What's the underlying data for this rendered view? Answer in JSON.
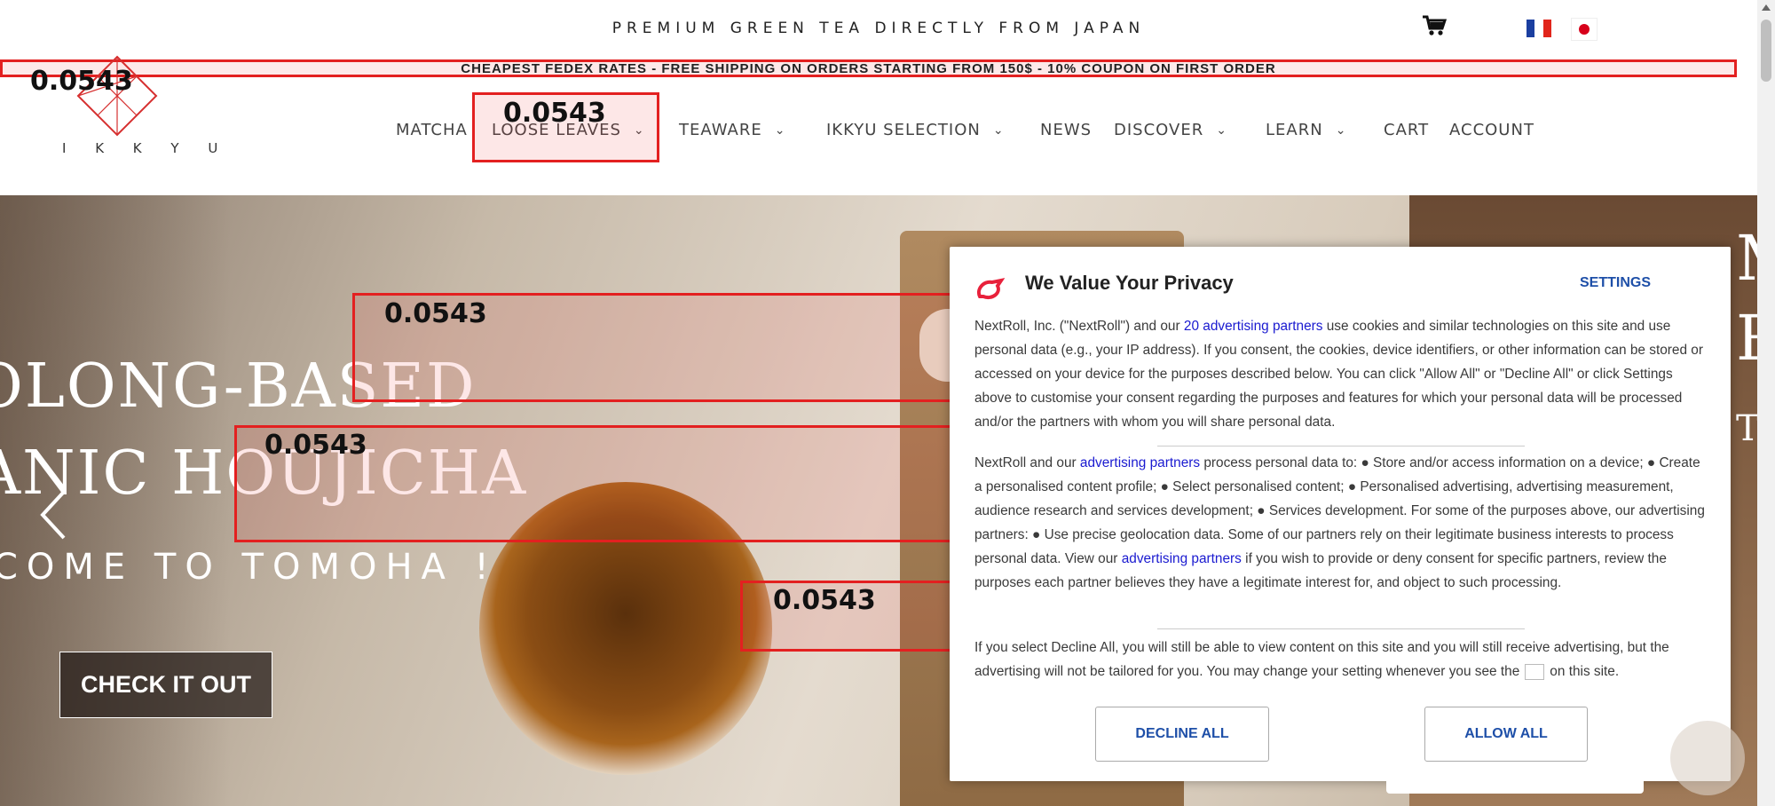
{
  "topbar": {
    "tagline": "PREMIUM GREEN TEA DIRECTLY FROM JAPAN",
    "cart_icon": "shopping-cart-icon",
    "languages": [
      "fr",
      "jp"
    ]
  },
  "announcement": "CHEAPEST FEDEX RATES - FREE SHIPPING ON ORDERS STARTING FROM 150$ - 10% COUPON ON FIRST ORDER",
  "logo": {
    "text": "I K K Y U"
  },
  "nav": {
    "items": [
      {
        "label": "MATCHA",
        "has_dropdown": false
      },
      {
        "label": "LOOSE LEAVES",
        "has_dropdown": true
      },
      {
        "label": "TEAWARE",
        "has_dropdown": true
      },
      {
        "label": "IKKYU SELECTION",
        "has_dropdown": true
      },
      {
        "label": "NEWS",
        "has_dropdown": false
      },
      {
        "label": "DISCOVER",
        "has_dropdown": true
      },
      {
        "label": "LEARN",
        "has_dropdown": true
      },
      {
        "label": "CART",
        "has_dropdown": false
      },
      {
        "label": "ACCOUNT",
        "has_dropdown": false
      }
    ]
  },
  "hero": {
    "title_line1": "OLONG-BASED",
    "title_line2": "ANIC HOUJICHA",
    "subtitle": "COME TO TOMOHA !",
    "cta": "CHECK IT OUT",
    "right_text1": "M",
    "right_text2": "R",
    "right_text3": "T"
  },
  "overlays": {
    "scores": [
      "0.0543",
      "0.0543",
      "0.0543",
      "0.0543",
      "0.0543"
    ]
  },
  "privacy_modal": {
    "title": "We Value Your Privacy",
    "settings_label": "SETTINGS",
    "para1_pre": "NextRoll, Inc. (\"NextRoll\") and our ",
    "para1_link": "20 advertising partners",
    "para1_post": " use cookies and similar technologies on this site and use personal data (e.g., your IP address). If you consent, the cookies, device identifiers, or other information can be stored or accessed on your device for the purposes described below. You can click \"Allow All\" or \"Decline All\" or click Settings above to customise your consent regarding the purposes and features for which your personal data will be processed and/or the partners with whom you will share personal data.",
    "para2_pre": "NextRoll and our ",
    "para2_link1": "advertising partners",
    "para2_mid": " process personal data to: ● Store and/or access information on a device; ● Create a personalised content profile; ● Select personalised content; ● Personalised advertising, advertising measurement, audience research and services development; ● Services development. For some of the purposes above, our advertising partners: ● Use precise geolocation data. Some of our partners rely on their legitimate business interests to process personal data. View our ",
    "para2_link2": "advertising partners",
    "para2_post": " if you wish to provide or deny consent for specific partners, review the purposes each partner believes they have a legitimate interest for, and object to such processing.",
    "para3_pre": "If you select Decline All, you will still be able to view content on this site and you will still receive advertising, but the advertising will not be tailored for you. You may change your setting whenever you see the",
    "para3_post": "on this site.",
    "decline_label": "DECLINE ALL",
    "allow_label": "ALLOW ALL"
  },
  "colors": {
    "accent_blue": "#1e4fa8",
    "overlay_red": "#e32020",
    "link_blue": "#1a1ad0",
    "nextroll_red": "#e8213b"
  }
}
